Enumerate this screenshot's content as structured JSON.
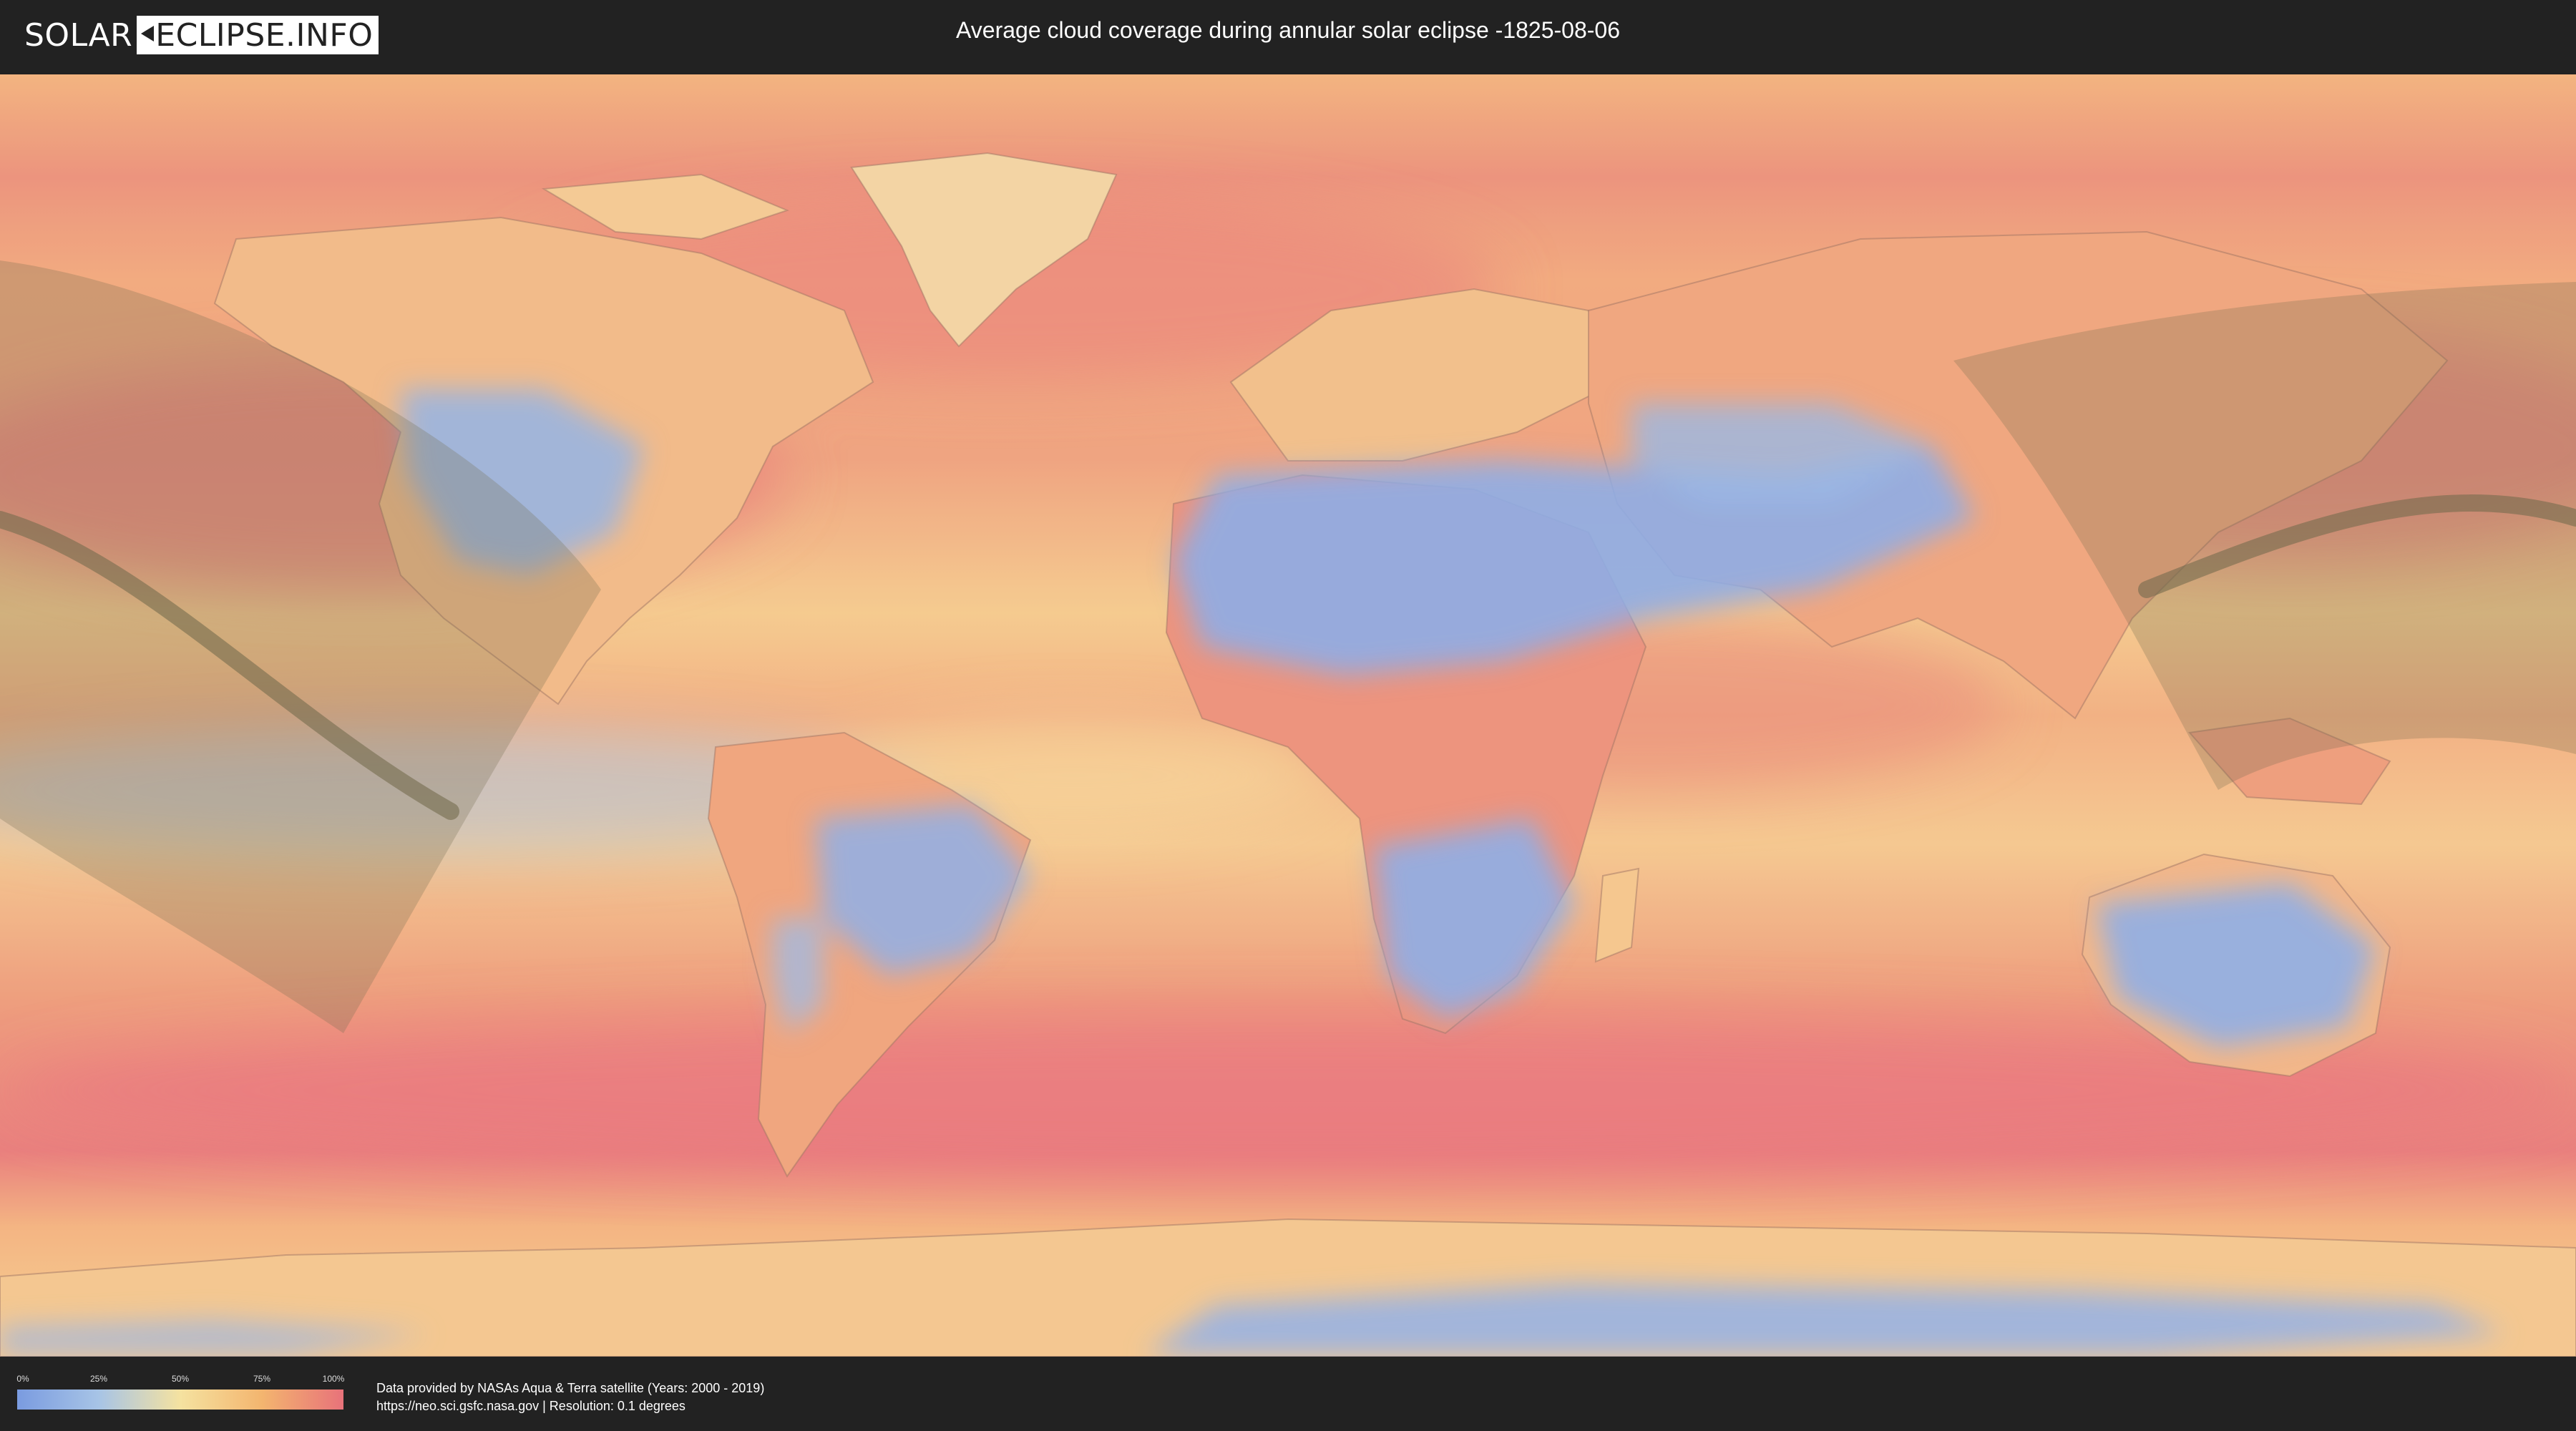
{
  "header": {
    "logo_left": "SOLAR",
    "logo_right": "ECLIPSE.INFO",
    "title": "Average cloud coverage during annular solar eclipse -1825-08-06"
  },
  "legend": {
    "ticks": [
      "0%",
      "25%",
      "50%",
      "75%",
      "100%"
    ],
    "tick_values": [
      0,
      25,
      50,
      75,
      100
    ],
    "colors": [
      "#7a9be0",
      "#a7c4e6",
      "#f5e2a0",
      "#f3b56f",
      "#e8727a"
    ]
  },
  "credits": {
    "line1": "Data provided by NASAs Aqua & Terra satellite (Years: 2000 - 2019)",
    "line2": "https://neo.sci.gsfc.nasa.gov | Resolution: 0.1 degrees"
  },
  "map": {
    "projection": "equirectangular",
    "eclipse_path_color": "#6b6345",
    "ocean_tint": "#f1a27a"
  }
}
